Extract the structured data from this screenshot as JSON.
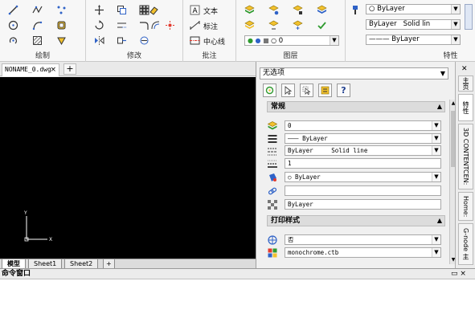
{
  "ribbon": {
    "panels": {
      "draw": "绘制",
      "modify": "修改",
      "annotation": "批注",
      "layers": "图层",
      "properties": "特性"
    },
    "annotation": {
      "text": "文本",
      "dimension": "标注",
      "centerline": "中心线"
    },
    "layers": {
      "current_layer": "0"
    },
    "properties": {
      "color": "ByLayer",
      "linetype": "ByLayer",
      "linetype_preview": "Solid lin",
      "lineweight": "ByLayer"
    }
  },
  "document": {
    "tab_name": "NONAME_0.dwg",
    "close_glyph": "×",
    "add_glyph": "+"
  },
  "ucs": {
    "y": "Y",
    "x": "X"
  },
  "layout_tabs": [
    "模型",
    "Sheet1",
    "Sheet2"
  ],
  "layout_add": "+",
  "palette": {
    "selection": "无选项",
    "categories": {
      "general": "常规",
      "plot_style": "打印样式"
    },
    "general": {
      "layer": "0",
      "linetype_line": "———",
      "linetype": "ByLayer",
      "linetype_scale_label": "ByLayer",
      "linetype_scale_value": "Solid line",
      "lineweight": "1",
      "color": "ByLayer",
      "hyperlink": "",
      "transparency": "ByLayer"
    },
    "plot_style": {
      "plot_style": "否",
      "plot_table": "monochrome.ctb"
    },
    "toolbar_help": "?"
  },
  "side_tabs": [
    "主页",
    "特性",
    "3D CONTENTCEN:",
    "Home:",
    "G-node 主"
  ],
  "command_window": {
    "title": "命令窗口",
    "controls": "▭ ×"
  },
  "colors": {
    "canvas": "#000000",
    "ribbon": "#f7f7f7",
    "layer_yellow": "#f2c12e",
    "accent_green": "#2e9a2e",
    "accent_blue": "#2f62c7"
  }
}
